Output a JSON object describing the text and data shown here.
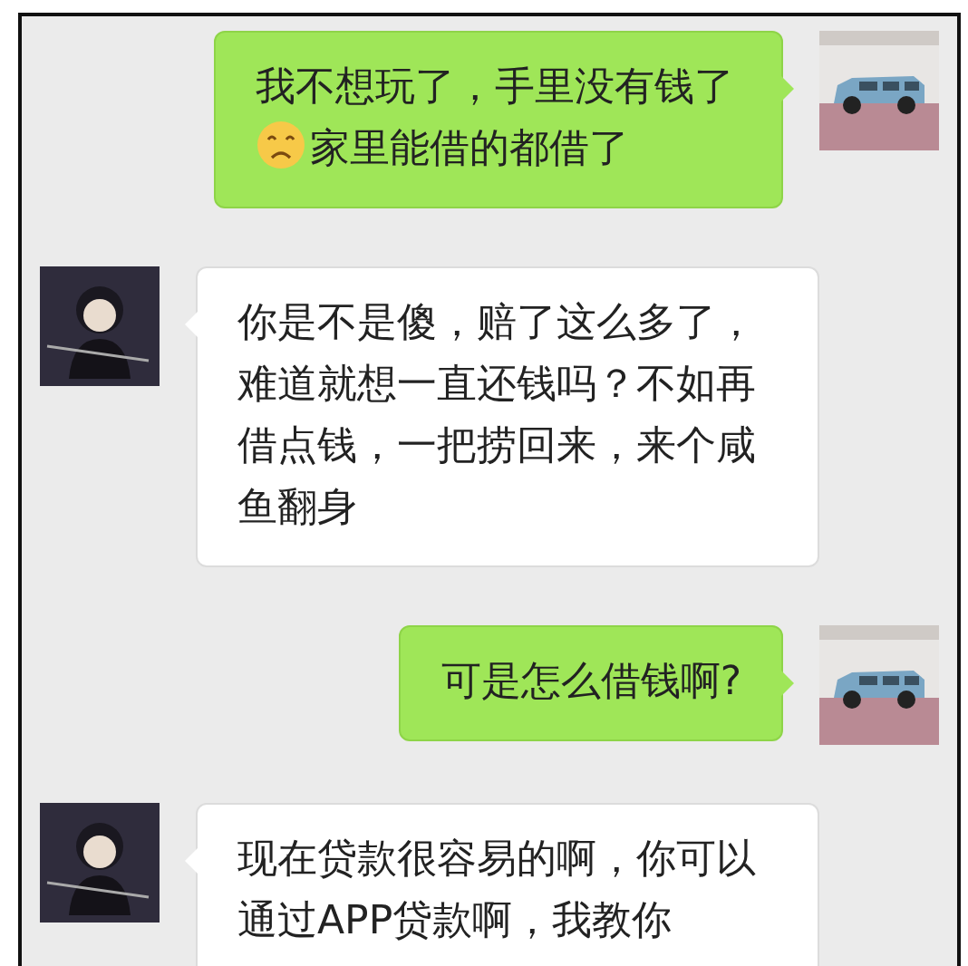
{
  "messages": [
    {
      "kind": "sent",
      "segments": [
        {
          "kind": "text",
          "text": "我不想玩了，手里没有钱了"
        },
        {
          "kind": "emoji"
        },
        {
          "kind": "text",
          "text": "家里能借的都借了"
        }
      ]
    },
    {
      "kind": "received",
      "segments": [
        {
          "kind": "text",
          "text": "你是不是傻，赔了这么多了，难道就想一直还钱吗？不如再借点钱，一把捞回来，来个咸鱼翻身"
        }
      ]
    },
    {
      "kind": "sent",
      "segments": [
        {
          "kind": "text",
          "text": "可是怎么借钱啊?"
        }
      ]
    },
    {
      "kind": "received",
      "segments": [
        {
          "kind": "text",
          "text": "现在贷款很容易的啊，你可以通过APP贷款啊，我教你"
        }
      ]
    }
  ]
}
